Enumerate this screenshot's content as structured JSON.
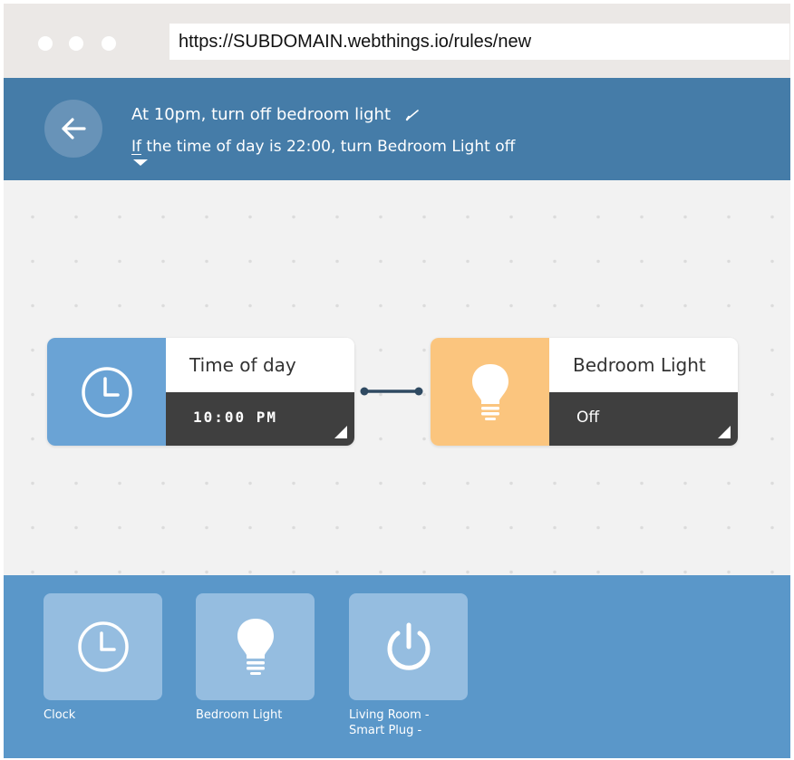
{
  "browser": {
    "url": "https://SUBDOMAIN.webthings.io/rules/new"
  },
  "header": {
    "rule_name": "At 10pm, turn off bedroom light",
    "description_if": "If",
    "description_rest": " the time of day is 22:00, turn Bedroom Light off"
  },
  "canvas": {
    "trigger": {
      "name": "Time of day",
      "value": "10:00 PM",
      "icon": "clock-icon"
    },
    "action": {
      "name": "Bedroom Light",
      "value": "Off",
      "icon": "light-bulb-icon"
    }
  },
  "palette": {
    "items": [
      {
        "label": "Clock",
        "icon": "clock-icon"
      },
      {
        "label": "Bedroom Light",
        "icon": "light-bulb-icon"
      },
      {
        "label": "Living Room - Smart Plug -",
        "icon": "power-icon"
      }
    ]
  },
  "colors": {
    "header": "#457ca8",
    "palette": "#5a97c9",
    "trigger_accent": "#6aa3d5",
    "action_accent": "#fbc57e",
    "value_bar": "#3f3f3f"
  }
}
